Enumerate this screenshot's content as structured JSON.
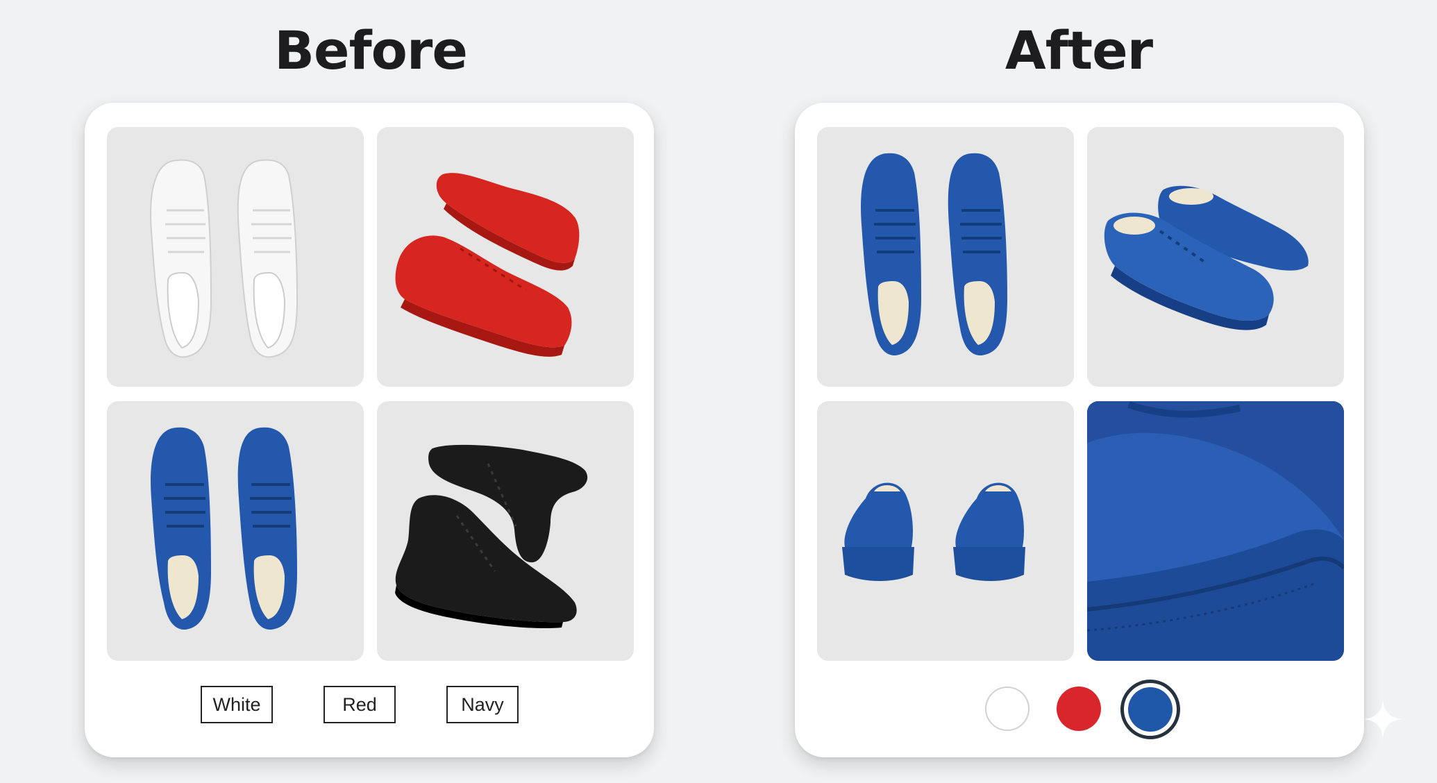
{
  "before": {
    "title": "Before",
    "labels": [
      "White",
      "Red",
      "Navy"
    ]
  },
  "after": {
    "title": "After",
    "swatches": [
      {
        "name": "white",
        "color": "#ffffff"
      },
      {
        "name": "red",
        "color": "#d9262d"
      },
      {
        "name": "navy",
        "color": "#1f58a8",
        "selected": true
      }
    ]
  },
  "colors": {
    "background": "#f1f2f4",
    "panel": "#ffffff",
    "tile": "#e7e7e8",
    "shoe_white": "#f7f7f7",
    "shoe_red": "#d7261f",
    "shoe_blue": "#2358ad",
    "shoe_black": "#1b1b1b",
    "insole": "#efe6cf"
  },
  "icons": [
    "sparkle-icon"
  ]
}
